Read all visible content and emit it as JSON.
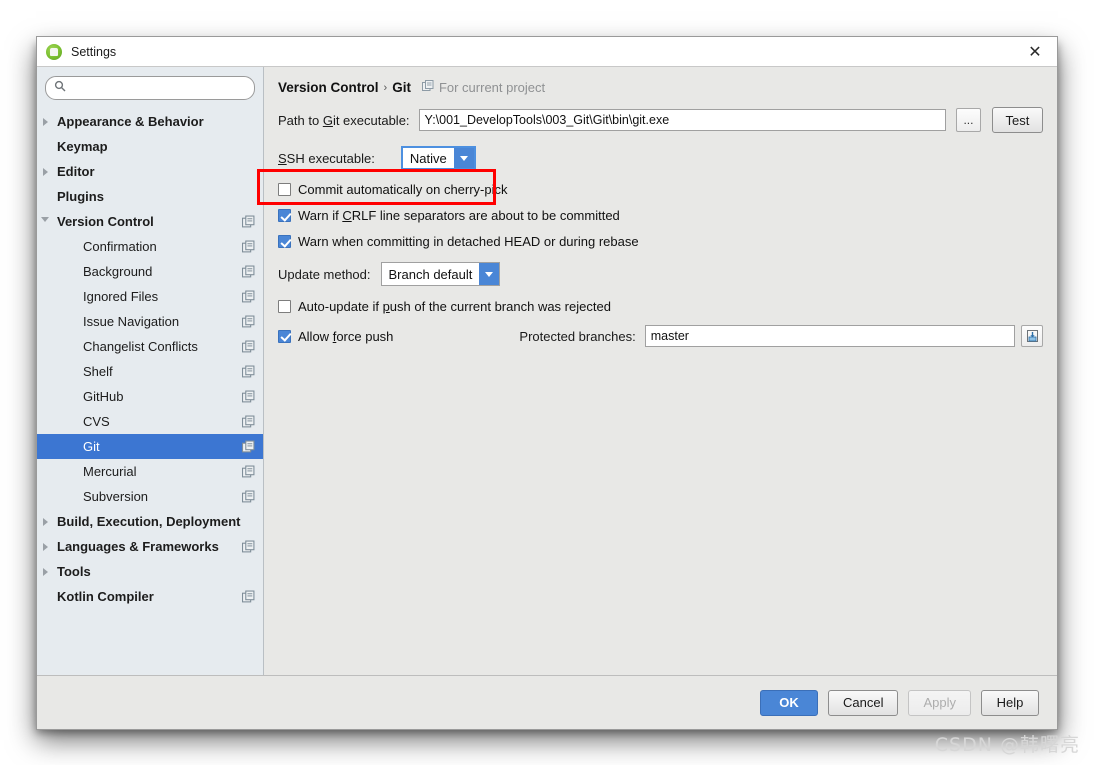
{
  "window": {
    "title": "Settings",
    "app_icon": "android-studio-icon",
    "close_icon": "close-icon"
  },
  "sidebar": {
    "search": {
      "value": "",
      "placeholder": "",
      "icon": "search-icon"
    },
    "items": [
      {
        "label": "Appearance & Behavior",
        "level": "top",
        "arrow": "right",
        "scope_icon": false,
        "selected": false
      },
      {
        "label": "Keymap",
        "level": "top",
        "arrow": "none",
        "scope_icon": false,
        "selected": false
      },
      {
        "label": "Editor",
        "level": "top",
        "arrow": "right",
        "scope_icon": false,
        "selected": false
      },
      {
        "label": "Plugins",
        "level": "top",
        "arrow": "none",
        "scope_icon": false,
        "selected": false
      },
      {
        "label": "Version Control",
        "level": "top",
        "arrow": "down",
        "scope_icon": true,
        "selected": false
      },
      {
        "label": "Confirmation",
        "level": "child",
        "arrow": "none",
        "scope_icon": true,
        "selected": false
      },
      {
        "label": "Background",
        "level": "child",
        "arrow": "none",
        "scope_icon": true,
        "selected": false
      },
      {
        "label": "Ignored Files",
        "level": "child",
        "arrow": "none",
        "scope_icon": true,
        "selected": false
      },
      {
        "label": "Issue Navigation",
        "level": "child",
        "arrow": "none",
        "scope_icon": true,
        "selected": false
      },
      {
        "label": "Changelist Conflicts",
        "level": "child",
        "arrow": "none",
        "scope_icon": true,
        "selected": false
      },
      {
        "label": "Shelf",
        "level": "child",
        "arrow": "none",
        "scope_icon": true,
        "selected": false
      },
      {
        "label": "GitHub",
        "level": "child",
        "arrow": "none",
        "scope_icon": true,
        "selected": false
      },
      {
        "label": "CVS",
        "level": "child",
        "arrow": "none",
        "scope_icon": true,
        "selected": false
      },
      {
        "label": "Git",
        "level": "child",
        "arrow": "none",
        "scope_icon": true,
        "selected": true
      },
      {
        "label": "Mercurial",
        "level": "child",
        "arrow": "none",
        "scope_icon": true,
        "selected": false
      },
      {
        "label": "Subversion",
        "level": "child",
        "arrow": "none",
        "scope_icon": true,
        "selected": false
      },
      {
        "label": "Build, Execution, Deployment",
        "level": "top",
        "arrow": "right",
        "scope_icon": false,
        "selected": false
      },
      {
        "label": "Languages & Frameworks",
        "level": "top",
        "arrow": "right",
        "scope_icon": true,
        "selected": false
      },
      {
        "label": "Tools",
        "level": "top",
        "arrow": "right",
        "scope_icon": false,
        "selected": false
      },
      {
        "label": "Kotlin Compiler",
        "level": "top",
        "arrow": "none",
        "scope_icon": true,
        "selected": false
      }
    ]
  },
  "main": {
    "breadcrumb": {
      "parent": "Version Control",
      "separator": "›",
      "current": "Git",
      "scope_text": "For current project",
      "scope_icon": "project-scope-icon"
    },
    "git_path": {
      "label_prefix": "Path to ",
      "label_accel": "G",
      "label_suffix": "it executable:",
      "value": "Y:\\001_DevelopTools\\003_Git\\Git\\bin\\git.exe",
      "browse_label": "...",
      "test_label": "Test"
    },
    "ssh": {
      "label_accel": "S",
      "label_rest": "SH executable:",
      "value": "Native",
      "highlighted": true,
      "highlight_color": "#ff0000"
    },
    "checkboxes": [
      {
        "label": "Commit automatically on cherry-pick",
        "checked": false,
        "accel": ""
      },
      {
        "label": "Warn if CRLF line separators are about to be committed",
        "checked": true,
        "accel": "CRLF"
      },
      {
        "label": "Warn when committing in detached HEAD or during rebase",
        "checked": true,
        "accel": ""
      }
    ],
    "update_method": {
      "label": "Update method:",
      "value": "Branch default"
    },
    "auto_update": {
      "label": "Auto-update if push of the current branch was rejected",
      "checked": false
    },
    "force_push": {
      "label": "Allow force push",
      "checked": true
    },
    "protected_branches": {
      "label": "Protected branches:",
      "value": "master",
      "expand_icon": "expand-field-icon"
    }
  },
  "footer": {
    "ok": "OK",
    "cancel": "Cancel",
    "apply": "Apply",
    "help": "Help",
    "apply_disabled": true,
    "ok_color": "#4a86d6"
  },
  "watermark": "CSDN @韩曙亮"
}
